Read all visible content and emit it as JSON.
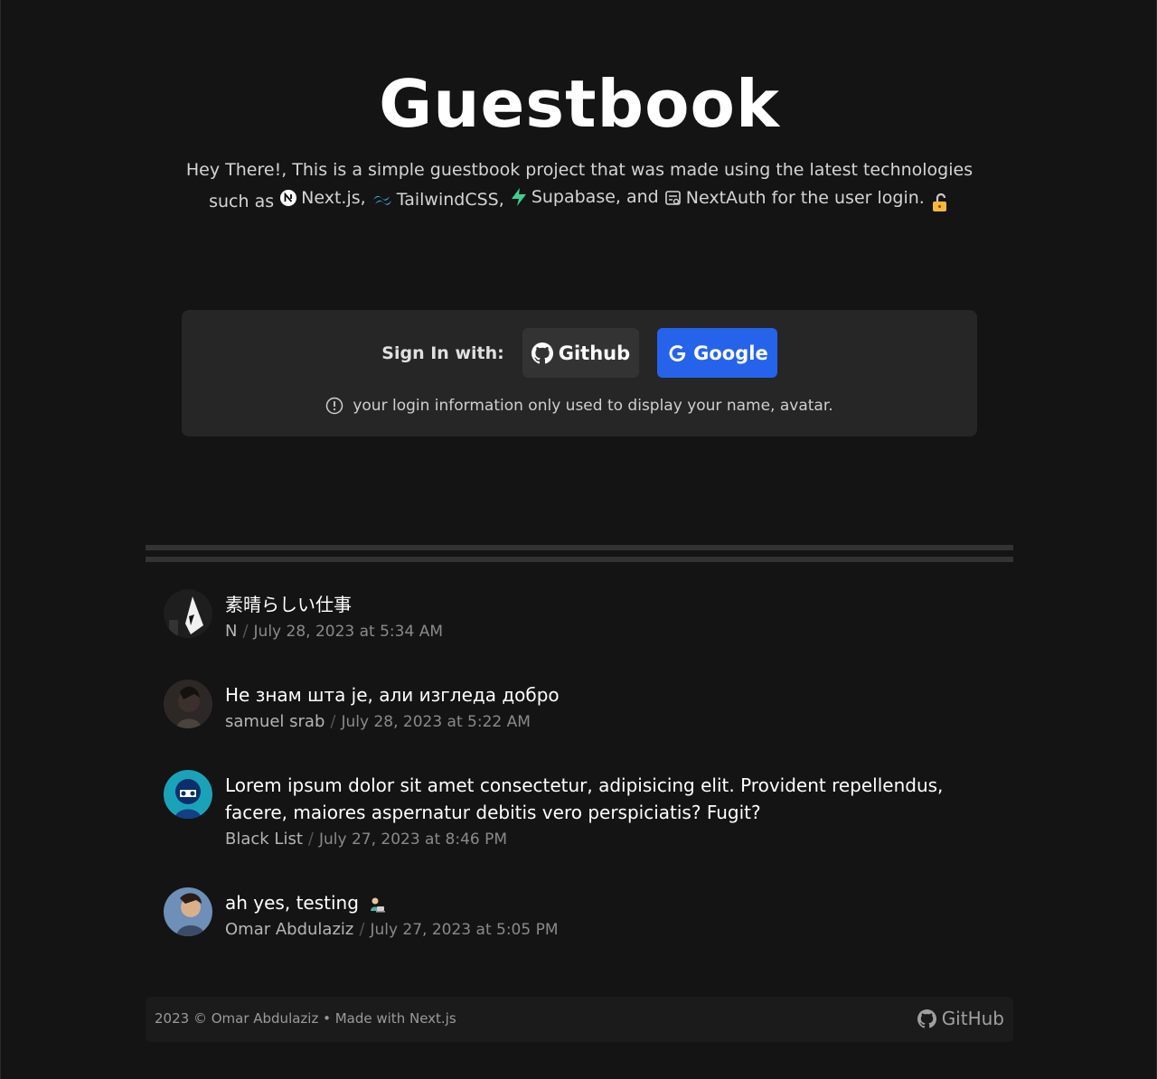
{
  "header": {
    "title": "Guestbook",
    "intro_line1": "Hey There!, This is a simple guestbook project that was made using the latest technologies",
    "intro_prefix": "such as",
    "tech_nextjs": "Next.js,",
    "tech_tailwind": "TailwindCSS,",
    "tech_supabase": "Supabase, and",
    "tech_nextauth": "NextAuth for the user login."
  },
  "signin": {
    "label": "Sign In with:",
    "github_label": "Github",
    "google_label": "Google",
    "note": "your login information only used to display your name, avatar."
  },
  "entries": [
    {
      "message": "素晴らしい仕事",
      "author": "N",
      "date": "July 28, 2023 at 5:34 AM"
    },
    {
      "message": "Не знам шта је, али изгледа добро",
      "author": "samuel srab",
      "date": "July 28, 2023 at 5:22 AM"
    },
    {
      "message": "Lorem ipsum dolor sit amet consectetur, adipisicing elit. Provident repellendus, facere, maiores aspernatur debitis vero perspiciatis? Fugit?",
      "author": "Black List",
      "date": "July 27, 2023 at 8:46 PM"
    },
    {
      "message": "ah yes, testing",
      "author": "Omar Abdulaziz",
      "date": "July 27, 2023 at 5:05 PM"
    }
  ],
  "footer": {
    "copyright": "2023 © Omar Abdulaziz • Made with Next.js",
    "github_link": "GitHub"
  },
  "colors": {
    "background": "#141414",
    "card": "#262626",
    "google_button": "#2563eb",
    "github_button": "#333333",
    "supabase": "#3ecf8e",
    "tailwind": "#38bdf8",
    "lock": "#f5b83d"
  },
  "icons": [
    "nextjs-icon",
    "tailwind-icon",
    "supabase-icon",
    "nextauth-icon",
    "lock-icon",
    "github-icon",
    "google-icon",
    "info-icon",
    "technologist-emoji-icon"
  ]
}
